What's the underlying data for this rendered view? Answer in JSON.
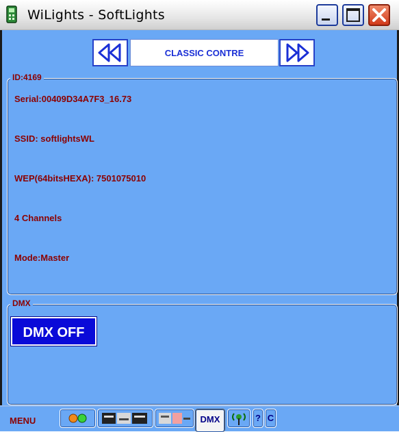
{
  "window": {
    "title": "WiLights - SoftLights",
    "icon": "app-device-icon",
    "buttons": [
      "minimize-icon",
      "maximize-icon",
      "close-icon"
    ]
  },
  "nav": {
    "title": "CLASSIC CONTRE",
    "prev_icon": "double-chevron-left-icon",
    "next_icon": "double-chevron-right-icon"
  },
  "info_group": {
    "legend": "ID:4169",
    "lines": [
      "Serial:00409D34A7F3_16.73",
      "SSID: softlightsWL",
      "WEP(64bitsHEXA): 7501075010",
      "4 Channels",
      "Mode:Master"
    ]
  },
  "dmx_group": {
    "legend": "DMX",
    "button_label": "DMX OFF"
  },
  "bottom_bar": {
    "menu_label": "MENU",
    "tabs": [
      {
        "icon": "status-lights-icon"
      },
      {
        "icon": "fader-panel-icon"
      },
      {
        "icon": "fader-mini-icon"
      },
      {
        "label": "DMX",
        "active": true
      },
      {
        "icon": "wireless-antenna-icon"
      },
      {
        "label": "?"
      },
      {
        "label": "C"
      }
    ]
  },
  "colors": {
    "panel_background": "#6aa8f5",
    "text_dark_red": "#8b0000",
    "nav_text_blue": "#1a2fd6",
    "dmx_button": "#0a0ad8"
  }
}
